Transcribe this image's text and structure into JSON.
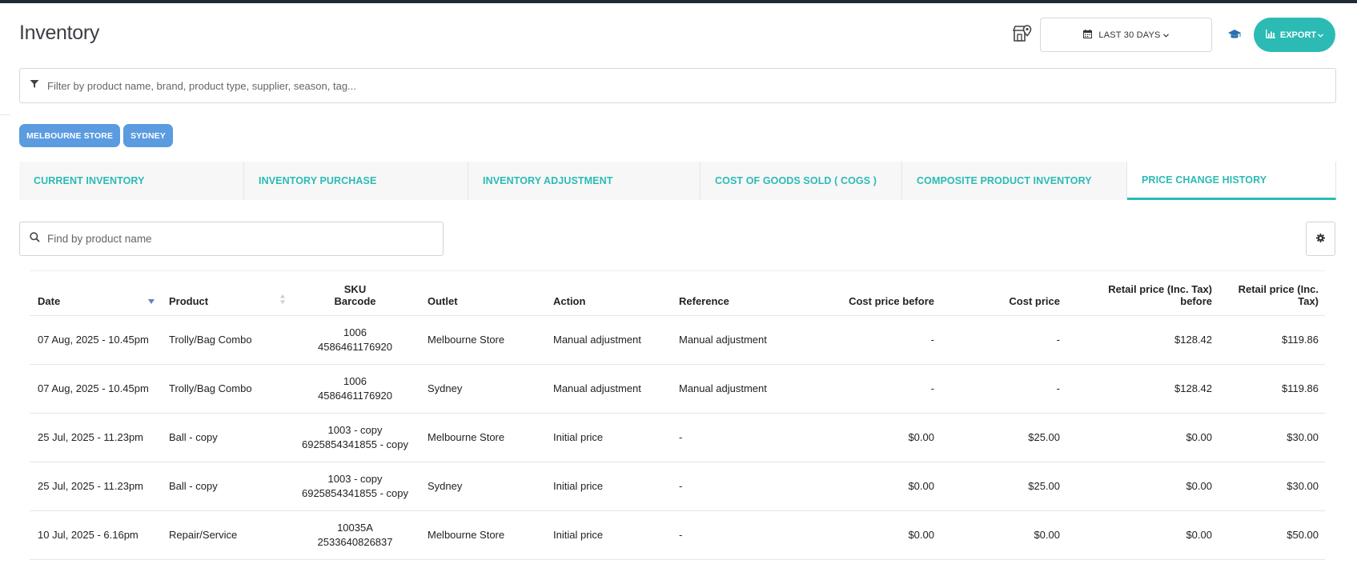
{
  "header": {
    "title": "Inventory",
    "date_range_label": "LAST 30 DAYS",
    "export_label": "EXPORT"
  },
  "filter": {
    "placeholder": "Filter by product name, brand, product type, supplier, season, tag..."
  },
  "outlet_chips": [
    "MELBOURNE STORE",
    "SYDNEY"
  ],
  "tabs": [
    {
      "label": "CURRENT INVENTORY",
      "active": false
    },
    {
      "label": "INVENTORY PURCHASE",
      "active": false
    },
    {
      "label": "INVENTORY ADJUSTMENT",
      "active": false
    },
    {
      "label": "COST OF GOODS SOLD ( COGS )",
      "active": false
    },
    {
      "label": "COMPOSITE PRODUCT INVENTORY",
      "active": false
    },
    {
      "label": "PRICE CHANGE HISTORY",
      "active": true
    }
  ],
  "search": {
    "placeholder": "Find by product name"
  },
  "table": {
    "columns": {
      "date": "Date",
      "product": "Product",
      "sku": "SKU",
      "barcode": "Barcode",
      "outlet": "Outlet",
      "action": "Action",
      "reference": "Reference",
      "cost_before": "Cost price before",
      "cost": "Cost price",
      "retail_before": "Retail price (Inc. Tax) before",
      "retail": "Retail price (Inc. Tax)"
    },
    "rows": [
      {
        "date": "07 Aug, 2025 - 10.45pm",
        "product": "Trolly/Bag Combo",
        "sku": "1006",
        "barcode": "4586461176920",
        "outlet": "Melbourne Store",
        "action": "Manual adjustment",
        "reference": "Manual adjustment",
        "cost_before": "-",
        "cost": "-",
        "retail_before": "$128.42",
        "retail": "$119.86"
      },
      {
        "date": "07 Aug, 2025 - 10.45pm",
        "product": "Trolly/Bag Combo",
        "sku": "1006",
        "barcode": "4586461176920",
        "outlet": "Sydney",
        "action": "Manual adjustment",
        "reference": "Manual adjustment",
        "cost_before": "-",
        "cost": "-",
        "retail_before": "$128.42",
        "retail": "$119.86"
      },
      {
        "date": "25 Jul, 2025 - 11.23pm",
        "product": "Ball - copy",
        "sku": "1003 - copy",
        "barcode": "6925854341855 - copy",
        "outlet": "Melbourne Store",
        "action": "Initial price",
        "reference": "-",
        "cost_before": "$0.00",
        "cost": "$25.00",
        "retail_before": "$0.00",
        "retail": "$30.00"
      },
      {
        "date": "25 Jul, 2025 - 11.23pm",
        "product": "Ball - copy",
        "sku": "1003 - copy",
        "barcode": "6925854341855 - copy",
        "outlet": "Sydney",
        "action": "Initial price",
        "reference": "-",
        "cost_before": "$0.00",
        "cost": "$25.00",
        "retail_before": "$0.00",
        "retail": "$30.00"
      },
      {
        "date": "10 Jul, 2025 - 6.16pm",
        "product": "Repair/Service",
        "sku": "10035A",
        "barcode": "2533640826837",
        "outlet": "Melbourne Store",
        "action": "Initial price",
        "reference": "-",
        "cost_before": "$0.00",
        "cost": "$0.00",
        "retail_before": "$0.00",
        "retail": "$50.00"
      }
    ]
  },
  "colors": {
    "accent": "#2bbbb4",
    "chip": "#5b9be0",
    "sort_arrow": "#6b7cc8"
  },
  "icons": {
    "store": "store-location-icon",
    "calendar": "calendar-icon",
    "graduation": "graduation-cap-icon",
    "chart": "bar-chart-icon",
    "filter": "filter-icon",
    "search": "search-icon",
    "gear": "gear-icon"
  }
}
